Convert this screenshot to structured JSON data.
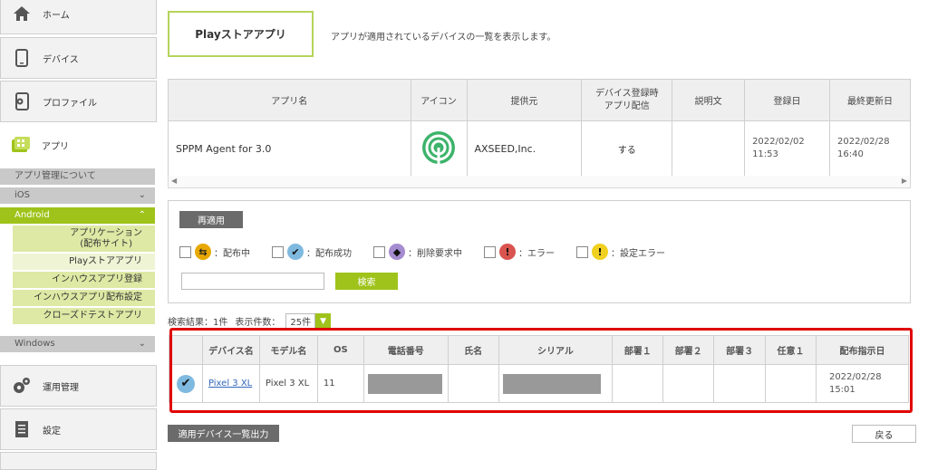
{
  "sidebar": {
    "nav": {
      "home": "ホーム",
      "device": "デバイス",
      "profile": "プロファイル",
      "app": "アプリ",
      "ops": "運用管理",
      "settings": "設定"
    },
    "groups": {
      "about": "アプリ管理について",
      "ios": "iOS",
      "android": "Android",
      "windows": "Windows"
    },
    "android_items": [
      "アプリケーション\n(配布サイト)",
      "Playストアアプリ",
      "インハウスアプリ登録",
      "インハウスアプリ配布設定",
      "クローズドテストアプリ"
    ]
  },
  "page": {
    "title": "Playストアアプリ",
    "description": "アプリが適用されているデバイスの一覧を表示します。"
  },
  "app_table": {
    "headers": [
      "アプリ名",
      "アイコン",
      "提供元",
      "デバイス登録時\nアプリ配信",
      "説明文",
      "登録日",
      "最終更新日"
    ],
    "row": {
      "name": "SPPM Agent for 3.0",
      "provider": "AXSEED,Inc.",
      "deliver": "する",
      "description": "",
      "registered": "2022/02/02\n11:53",
      "updated": "2022/02/28\n16:40"
    }
  },
  "filters": {
    "reapply_label": "再適用",
    "statuses": [
      {
        "label": "：配布中",
        "icon": "transfer-icon",
        "color": "#e8a800"
      },
      {
        "label": "：配布成功",
        "icon": "check-icon",
        "color": "#7fb9df"
      },
      {
        "label": "：削除要求中",
        "icon": "delete-request-icon",
        "color": "#a58bd0"
      },
      {
        "label": "：エラー",
        "icon": "error-icon",
        "color": "#d9534f"
      },
      {
        "label": "：設定エラー",
        "icon": "warning-icon",
        "color": "#f0d020"
      }
    ],
    "search_placeholder": "",
    "search_label": "検索"
  },
  "results": {
    "summary": "検索結果：1件",
    "per_page_label": "表示件数：",
    "per_page_value": "25件"
  },
  "device_table": {
    "headers": [
      "",
      "デバイス名",
      "モデル名",
      "OS",
      "電話番号",
      "氏名",
      "シリアル",
      "部署１",
      "部署２",
      "部署３",
      "任意１",
      "配布指示日"
    ],
    "row": {
      "device": "Pixel 3 XL",
      "model": "Pixel 3 XL",
      "os": "11",
      "phone": "",
      "name": "",
      "serial": "",
      "dept1": "",
      "dept2": "",
      "dept3": "",
      "opt1": "",
      "date": "2022/02/28\n15:01"
    }
  },
  "footer": {
    "export_label": "適用デバイス一覧出力",
    "back_label": "戻る"
  },
  "colors": {
    "accent": "#9fc31a",
    "highlight": "#e00000"
  }
}
